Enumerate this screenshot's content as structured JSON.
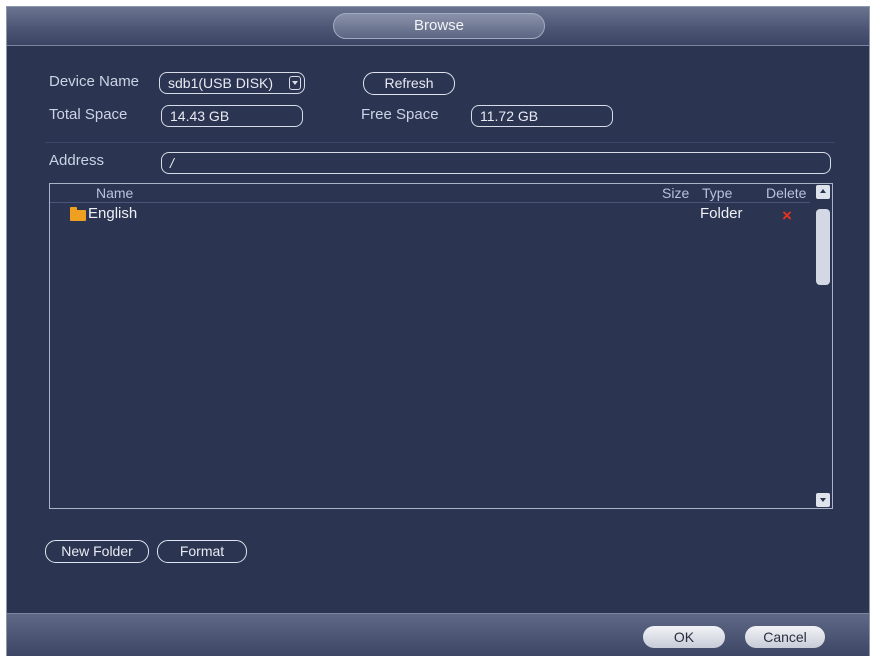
{
  "window": {
    "title": "Browse"
  },
  "device": {
    "name_label": "Device Name",
    "name_value": "sdb1(USB DISK)",
    "refresh_label": "Refresh",
    "total_label": "Total Space",
    "total_value": "14.43 GB",
    "free_label": "Free Space",
    "free_value": "11.72 GB"
  },
  "address": {
    "label": "Address",
    "value": "/"
  },
  "file_list": {
    "columns": {
      "name": "Name",
      "size": "Size",
      "type": "Type",
      "delete": "Delete"
    },
    "rows": [
      {
        "name": "English",
        "size": "",
        "type": "Folder",
        "icon": "folder-icon",
        "delete_icon": "×"
      }
    ]
  },
  "actions": {
    "new_folder": "New Folder",
    "format": "Format"
  },
  "footer": {
    "ok": "OK",
    "cancel": "Cancel"
  },
  "colors": {
    "background": "#2b3450",
    "delete": "#e8341c",
    "folder": "#f0a020"
  }
}
